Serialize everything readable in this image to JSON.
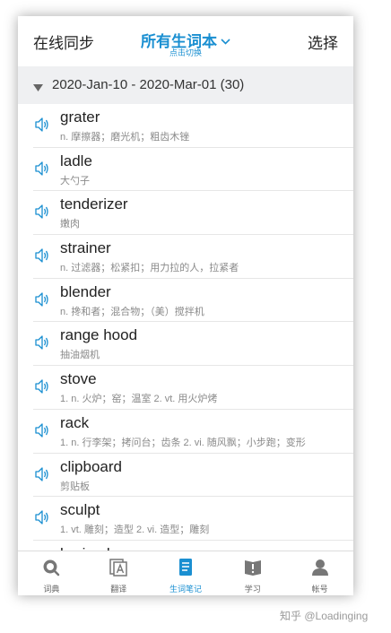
{
  "header": {
    "left_label": "在线同步",
    "title": "所有生词本",
    "subtitle": "点击切换",
    "right_label": "选择"
  },
  "group": {
    "label": "2020-Jan-10 - 2020-Mar-01 (30)"
  },
  "words": [
    {
      "word": "grater",
      "definition": "n. 摩擦器；磨光机；粗齿木锉"
    },
    {
      "word": "ladle",
      "definition": "大勺子"
    },
    {
      "word": "tenderizer",
      "definition": "嫩肉"
    },
    {
      "word": "strainer",
      "definition": "n. 过滤器；松紧扣；用力拉的人，拉紧者"
    },
    {
      "word": "blender",
      "definition": "n. 搀和者；混合物；（美）搅拌机"
    },
    {
      "word": "range hood",
      "definition": "抽油烟机"
    },
    {
      "word": "stove",
      "definition": "1. n. 火炉；窑；温室 2. vt. 用火炉烤"
    },
    {
      "word": "rack",
      "definition": "1. n. 行李架；拷问台；齿条 2. vi. 随风飘；小步跑；变形"
    },
    {
      "word": "clipboard",
      "definition": "剪贴板"
    },
    {
      "word": "sculpt",
      "definition": "1. vt. 雕刻；造型 2. vi. 造型；雕刻"
    },
    {
      "word": "braised",
      "definition": ""
    }
  ],
  "tabs": [
    {
      "label": "词典",
      "icon": "search-icon"
    },
    {
      "label": "翻译",
      "icon": "translate-icon"
    },
    {
      "label": "生词笔记",
      "icon": "notebook-icon"
    },
    {
      "label": "学习",
      "icon": "study-icon"
    },
    {
      "label": "帐号",
      "icon": "account-icon"
    }
  ],
  "active_tab": "生词笔记",
  "watermark": "知乎 @Loadinging",
  "colors": {
    "accent": "#1a8fd1",
    "group_header_bg": "#eff0f2",
    "definition_text": "#8a8a8a"
  }
}
